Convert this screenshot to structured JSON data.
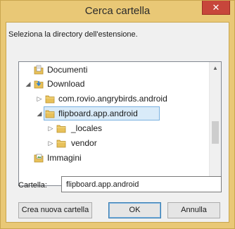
{
  "dialog": {
    "title": "Cerca cartella",
    "close_symbol": "✕",
    "instruction": "Seleziona la directory dell'estensione."
  },
  "tree": {
    "items": [
      {
        "label": "Documenti",
        "icon": "documents-folder-icon",
        "expander": "",
        "selected": false
      },
      {
        "label": "Download",
        "icon": "downloads-folder-icon",
        "expander": "◢",
        "selected": false
      },
      {
        "label": "com.rovio.angrybirds.android",
        "icon": "folder-icon",
        "expander": "▷",
        "selected": false
      },
      {
        "label": "flipboard.app.android",
        "icon": "folder-icon",
        "expander": "◢",
        "selected": true
      },
      {
        "label": "_locales",
        "icon": "folder-icon",
        "expander": "▷",
        "selected": false
      },
      {
        "label": "vendor",
        "icon": "folder-icon",
        "expander": "▷",
        "selected": false
      },
      {
        "label": "Immagini",
        "icon": "pictures-folder-icon",
        "expander": "",
        "selected": false
      }
    ],
    "scroll_up": "▲",
    "scroll_down": "▼"
  },
  "folder_field": {
    "label": "Cartella:",
    "value": "flipboard.app.android"
  },
  "buttons": {
    "new_folder": "Crea nuova cartella",
    "ok": "OK",
    "cancel": "Annulla"
  },
  "colors": {
    "frame": "#e9c876",
    "close": "#c7463b",
    "selection": "#d9ebf9",
    "folder": "#e8c15a"
  }
}
